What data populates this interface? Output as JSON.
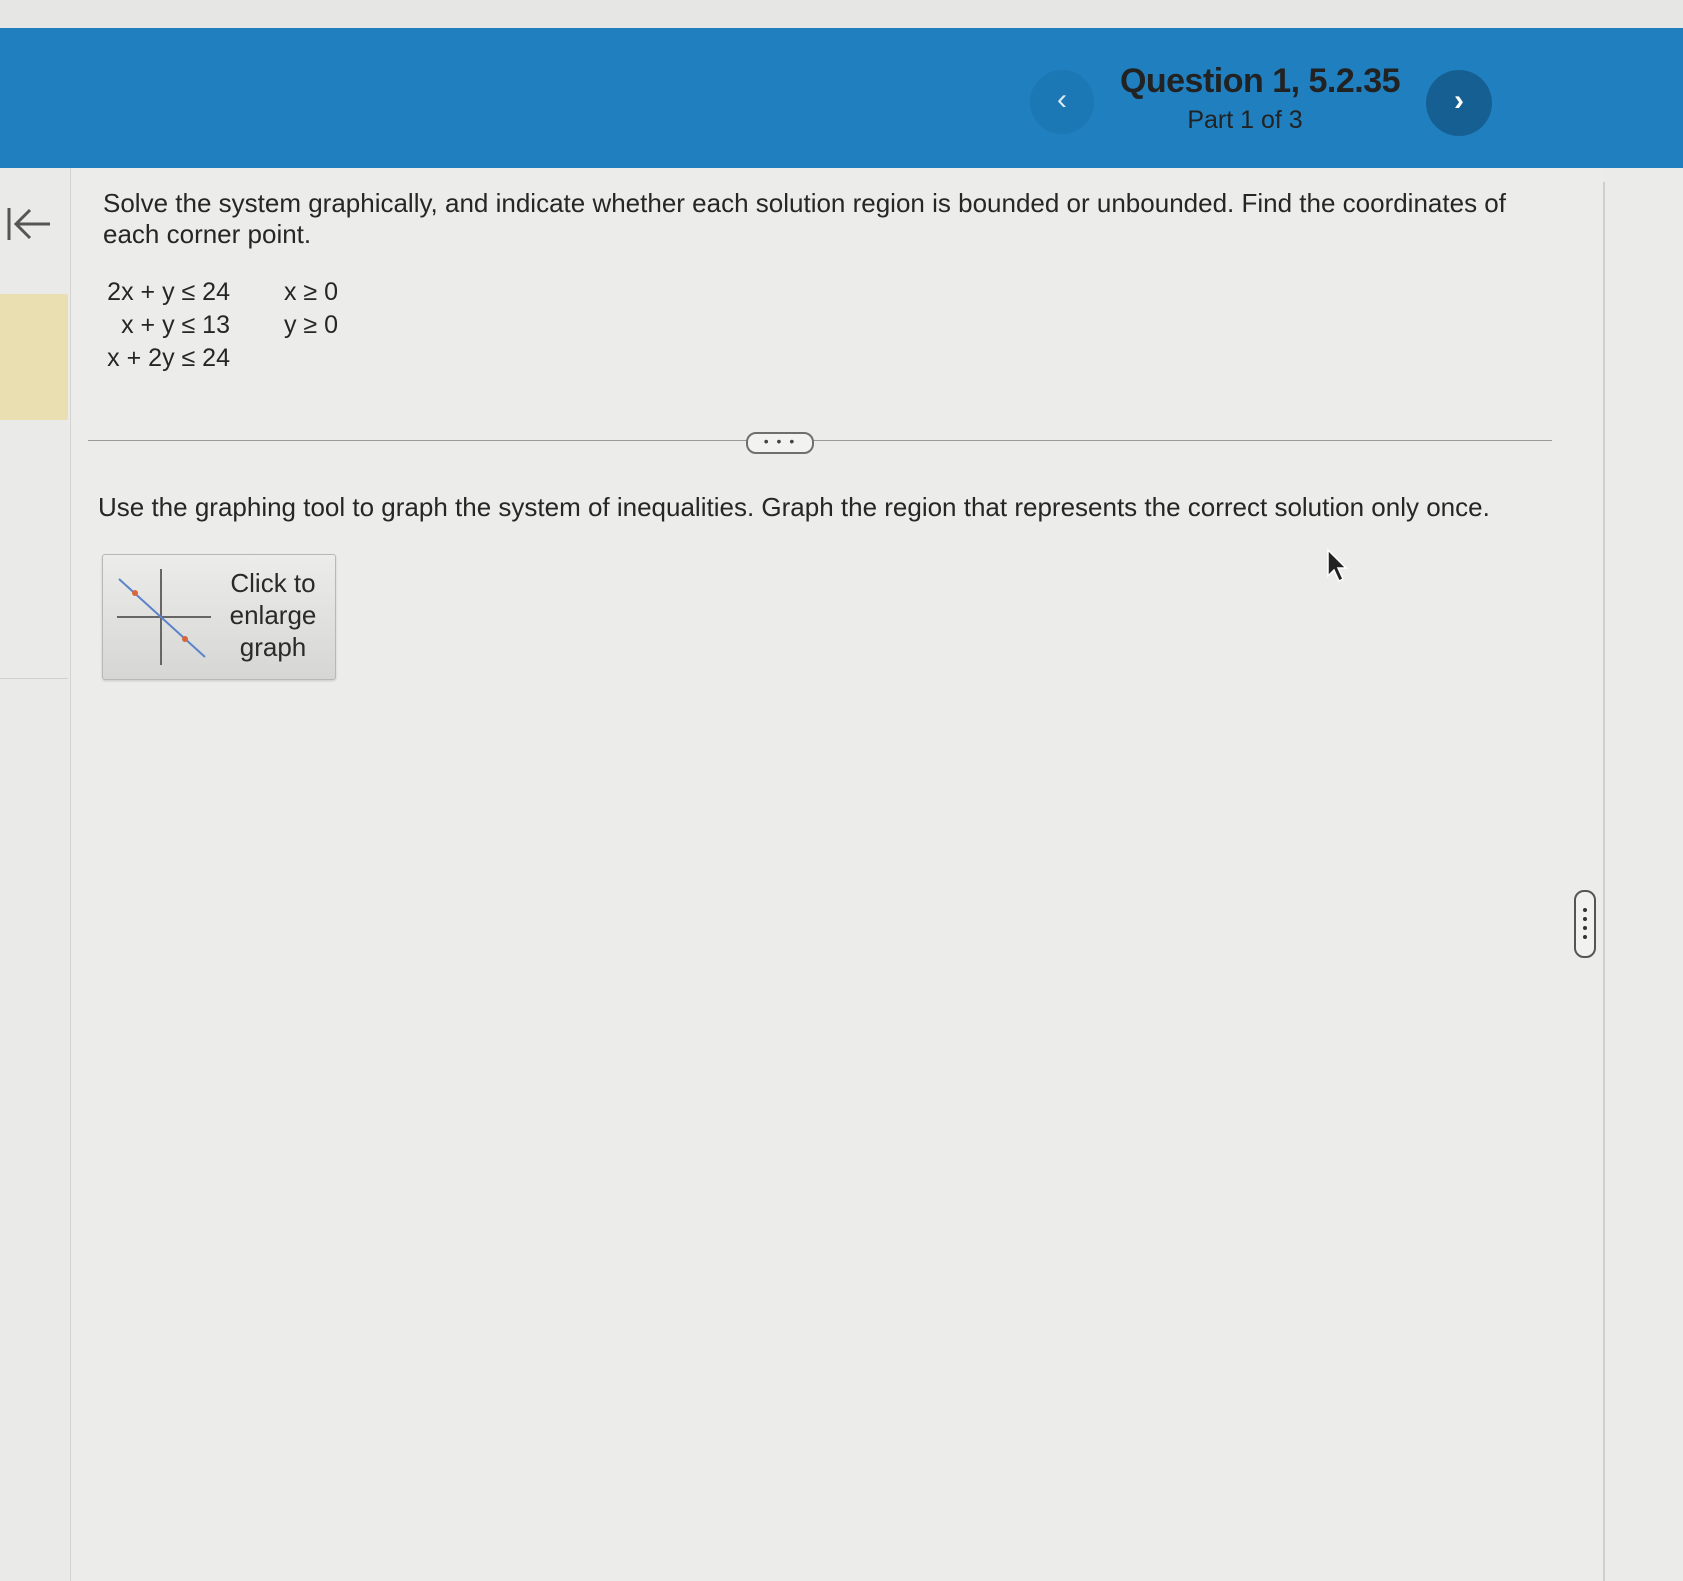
{
  "header": {
    "question_title": "Question 1, 5.2.35",
    "part_label": "Part 1 of 3",
    "prev_glyph": "‹",
    "next_glyph": "›",
    "background_color": "#1f7fbf"
  },
  "sidebar": {
    "back_icon": "collapse-left-arrow-icon"
  },
  "problem": {
    "prompt": "Solve the system graphically, and indicate whether each solution region is bounded or unbounded. Find the coordinates of each corner point.",
    "inequalities_left": [
      "2x + y ≤ 24",
      "x + y ≤ 13",
      "x + 2y ≤ 24"
    ],
    "inequalities_right": [
      "x ≥ 0",
      "y ≥ 0"
    ]
  },
  "divider": {
    "expand_label": "• • •"
  },
  "part": {
    "instruction": "Use the graphing tool to graph the system of inequalities. Graph the region that represents the correct solution only once.",
    "graph_button_label": "Click to enlarge graph",
    "graph_button_icon": "graph-thumbnail-icon"
  },
  "colors": {
    "accent": "#1f7fbf",
    "next_button": "#165f92",
    "rail_highlight": "#e9dfb1"
  }
}
